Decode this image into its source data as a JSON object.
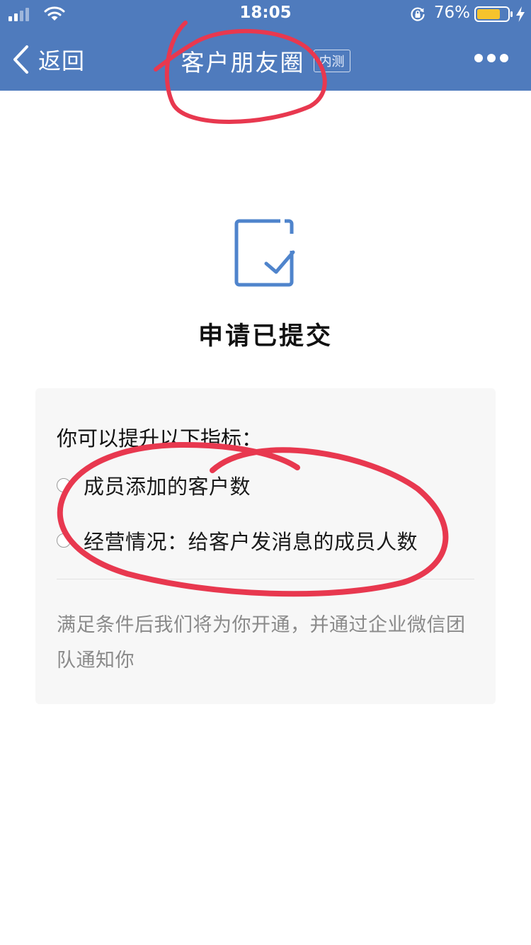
{
  "status_bar": {
    "time": "18:05",
    "battery_percent": "76%",
    "battery_level": 0.76,
    "battery_color": "#f5c32c"
  },
  "nav": {
    "back_label": "返回",
    "title": "客户朋友圈",
    "badge": "内测",
    "background": "#4f7bbd"
  },
  "result": {
    "title": "申请已提交",
    "icon_color": "#4f84cc"
  },
  "card": {
    "heading": "你可以提升以下指标：",
    "criteria": [
      "成员添加的客户数",
      "经营情况：给客户发消息的成员人数"
    ],
    "note": "满足条件后我们将为你开通，并通过企业微信团队通知你"
  },
  "annotation_color": "#e8384f",
  "icons": [
    "signal-icon",
    "wifi-icon",
    "rotation-lock-icon",
    "battery-icon",
    "charging-icon",
    "chevron-left-icon",
    "more-icon",
    "check-document-icon",
    "radio-icon"
  ]
}
